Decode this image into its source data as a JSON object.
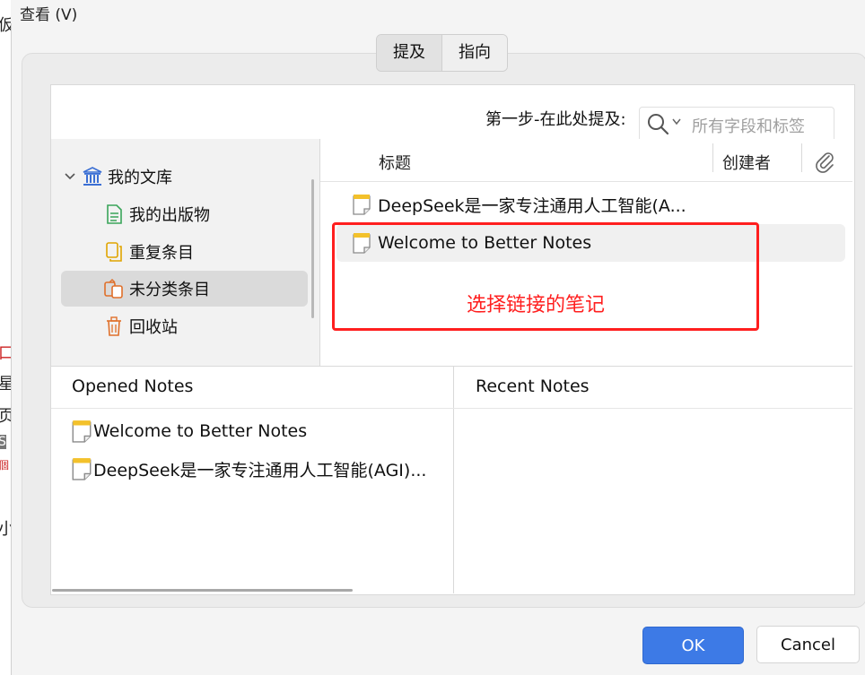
{
  "menu": {
    "view_label": "查看 (V)"
  },
  "tabs": [
    {
      "label": "提及"
    },
    {
      "label": "指向"
    }
  ],
  "search": {
    "prefix_label": "第一步-在此处提及:",
    "placeholder": "所有字段和标签"
  },
  "library_tree": {
    "root": "我的文库",
    "items": [
      {
        "label": "我的出版物"
      },
      {
        "label": "重复条目"
      },
      {
        "label": "未分类条目"
      },
      {
        "label": "回收站"
      }
    ],
    "selected": "未分类条目"
  },
  "items_table": {
    "columns": {
      "title": "标题",
      "creator": "创建者"
    },
    "rows": [
      {
        "title": "DeepSeek是一家专注通用人工智能(A..."
      },
      {
        "title": "Welcome to Better Notes"
      }
    ]
  },
  "annotation": {
    "text": "选择链接的笔记",
    "color": "#ff1f1f"
  },
  "opened_notes": {
    "header": "Opened Notes",
    "items": [
      {
        "title": "Welcome to Better Notes"
      },
      {
        "title": "DeepSeek是一家专注通用人工智能(AGI)..."
      }
    ]
  },
  "recent_notes": {
    "header": "Recent Notes",
    "items": []
  },
  "buttons": {
    "ok": "OK",
    "cancel": "Cancel"
  },
  "colors": {
    "accent": "#3d7ae6",
    "highlight_red": "#ff1f1f",
    "library_blue": "#3b6fd4",
    "publication_green": "#3aa55a",
    "duplicate_yellow": "#e0a400",
    "orange": "#e0702a",
    "note_yellow": "#f3c12b"
  },
  "background_window_glyphs": [
    "仮",
    "口",
    "星",
    "页",
    "S",
    "個",
    "小"
  ]
}
